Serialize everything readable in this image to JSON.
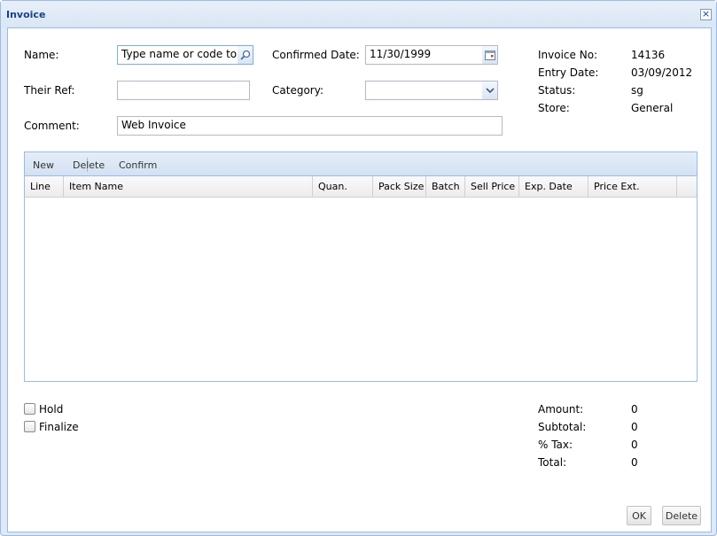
{
  "window": {
    "title": "Invoice",
    "close_label": "×"
  },
  "form": {
    "name_label": "Name:",
    "name_placeholder": "Type name or code to search",
    "name_value": "Type name or code to se",
    "their_ref_label": "Their Ref:",
    "their_ref_value": "",
    "comment_label": "Comment:",
    "comment_value": "Web Invoice",
    "confirmed_date_label": "Confirmed Date:",
    "confirmed_date_value": "11/30/1999",
    "category_label": "Category:",
    "category_value": ""
  },
  "info": {
    "invoice_no_label": "Invoice No:",
    "invoice_no_value": "14136",
    "entry_date_label": "Entry Date:",
    "entry_date_value": "03/09/2012",
    "status_label": "Status:",
    "status_value": "sg",
    "store_label": "Store:",
    "store_value": "General"
  },
  "toolbar": {
    "new_label": "New",
    "delete_label": "Delete",
    "confirm_label": "Confirm"
  },
  "grid": {
    "columns": [
      "Line",
      "Item Name",
      "Quan.",
      "Pack Size",
      "Batch",
      "Sell Price",
      "Exp. Date",
      "Price Ext."
    ],
    "rows": []
  },
  "options": {
    "hold_label": "Hold",
    "hold_checked": false,
    "finalize_label": "Finalize",
    "finalize_checked": false
  },
  "totals": {
    "amount_label": "Amount:",
    "amount_value": "0",
    "subtotal_label": "Subtotal:",
    "subtotal_value": "0",
    "tax_label": "% Tax:",
    "tax_value": "0",
    "total_label": "Total:",
    "total_value": "0"
  },
  "footer": {
    "ok_label": "OK",
    "delete_label": "Delete"
  },
  "colors": {
    "title": "#15428b",
    "border": "#99bbe8",
    "panel_bg": "#dfe8f6"
  },
  "icons": {
    "search": "magnifier-icon",
    "date": "calendar-icon",
    "combo": "chevron-down-icon",
    "close": "close-icon"
  }
}
